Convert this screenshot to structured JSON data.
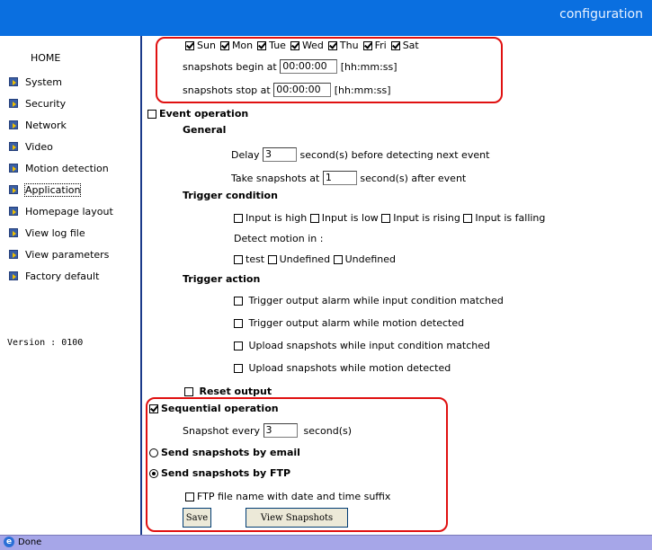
{
  "header": {
    "title": "configuration"
  },
  "sidebar": {
    "home": "HOME",
    "items": [
      {
        "label": "System"
      },
      {
        "label": "Security"
      },
      {
        "label": "Network"
      },
      {
        "label": "Video"
      },
      {
        "label": "Motion detection"
      },
      {
        "label": "Application"
      },
      {
        "label": "Homepage layout"
      },
      {
        "label": "View log file"
      },
      {
        "label": "View parameters"
      },
      {
        "label": "Factory default"
      }
    ],
    "version": "Version : 0100"
  },
  "schedule": {
    "days": [
      {
        "label": "Sun",
        "checked": true
      },
      {
        "label": "Mon",
        "checked": true
      },
      {
        "label": "Tue",
        "checked": true
      },
      {
        "label": "Wed",
        "checked": true
      },
      {
        "label": "Thu",
        "checked": true
      },
      {
        "label": "Fri",
        "checked": true
      },
      {
        "label": "Sat",
        "checked": true
      }
    ],
    "begin_label": "snapshots begin at",
    "begin_value": "00:00:00",
    "begin_unit": "[hh:mm:ss]",
    "stop_label": "snapshots stop at",
    "stop_value": "00:00:00",
    "stop_unit": "[hh:mm:ss]"
  },
  "event": {
    "label": "Event operation",
    "general_label": "General",
    "delay_label": "Delay",
    "delay_value": "3",
    "delay_suffix": "second(s) before detecting next event",
    "take_label": "Take snapshots at",
    "take_value": "1",
    "take_suffix": "second(s) after event",
    "trigger_condition_label": "Trigger condition",
    "inputs": [
      "Input is high",
      "Input is low",
      "Input is rising",
      "Input is falling"
    ],
    "detect_label": "Detect motion in :",
    "motion_windows": [
      "test",
      "Undefined",
      "Undefined"
    ],
    "trigger_action_label": "Trigger action",
    "actions": [
      "Trigger output alarm while input condition matched",
      "Trigger output alarm while motion detected",
      "Upload snapshots while input condition matched",
      "Upload snapshots while motion detected"
    ],
    "reset_label": "Reset output"
  },
  "sequential": {
    "label": "Sequential operation",
    "every_label": "Snapshot every",
    "every_value": "3",
    "every_suffix": "second(s)",
    "email_label": "Send snapshots by email",
    "ftp_label": "Send snapshots by FTP",
    "ftp_suffix_label": "FTP file name with date and time suffix"
  },
  "buttons": {
    "save": "Save",
    "view": "View Snapshots"
  },
  "status": {
    "text": "Done"
  }
}
